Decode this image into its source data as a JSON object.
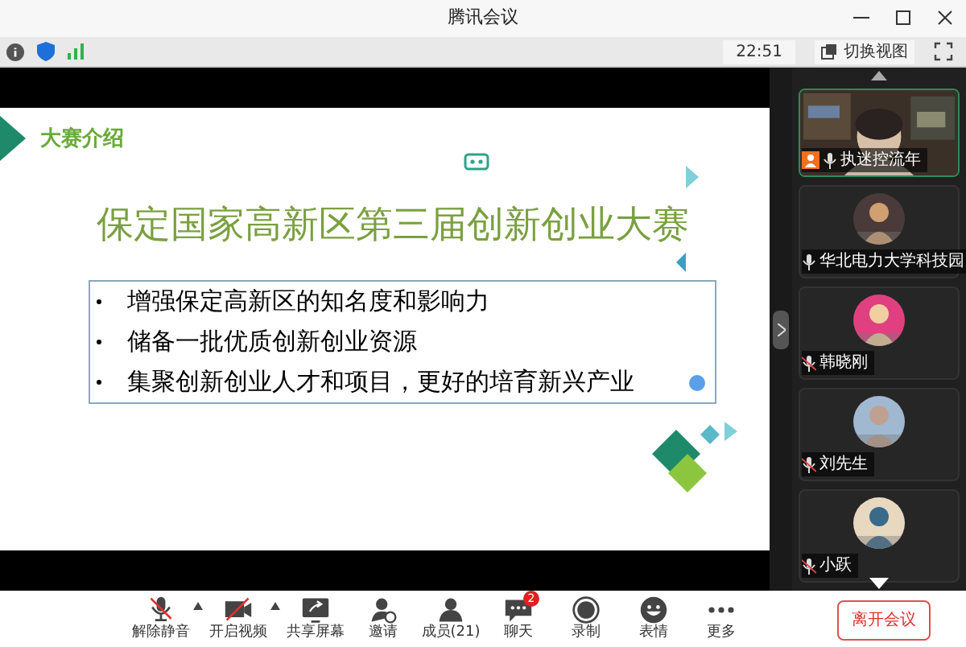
{
  "window": {
    "title": "腾讯会议"
  },
  "info_bar": {
    "time": "22:51",
    "switch_view": "切换视图"
  },
  "slide": {
    "section": "大赛介绍",
    "title": "保定国家高新区第三届创新创业大赛",
    "bullets": [
      "增强保定高新区的知名度和影响力",
      "储备一批优质创新创业资源",
      "集聚创新创业人才和项目，更好的培育新兴产业"
    ]
  },
  "participants": [
    {
      "name": "执迷控流年",
      "kind": "video",
      "muted": false,
      "host": true
    },
    {
      "name": "华北电力大学科技园",
      "kind": "avatar",
      "muted": false,
      "host": false
    },
    {
      "name": "韩晓刚",
      "kind": "avatar",
      "muted": true,
      "host": false
    },
    {
      "name": "刘先生",
      "kind": "avatar",
      "muted": true,
      "host": false
    },
    {
      "name": "小跃",
      "kind": "avatar",
      "muted": true,
      "host": false
    }
  ],
  "toolbar": [
    {
      "label": "解除静音",
      "kind": "mic",
      "caret": true
    },
    {
      "label": "开启视频",
      "kind": "camera",
      "caret": true
    },
    {
      "label": "共享屏幕",
      "kind": "share",
      "caret": false
    },
    {
      "label": "邀请",
      "kind": "invite",
      "caret": false
    },
    {
      "label": "成员(21)",
      "kind": "members",
      "caret": false
    },
    {
      "label": "聊天",
      "kind": "chat",
      "caret": false,
      "badge": "2"
    },
    {
      "label": "录制",
      "kind": "record",
      "caret": false
    },
    {
      "label": "表情",
      "kind": "emoji",
      "caret": false
    },
    {
      "label": "更多",
      "kind": "more",
      "caret": false
    }
  ],
  "leave_button": "离开会议"
}
